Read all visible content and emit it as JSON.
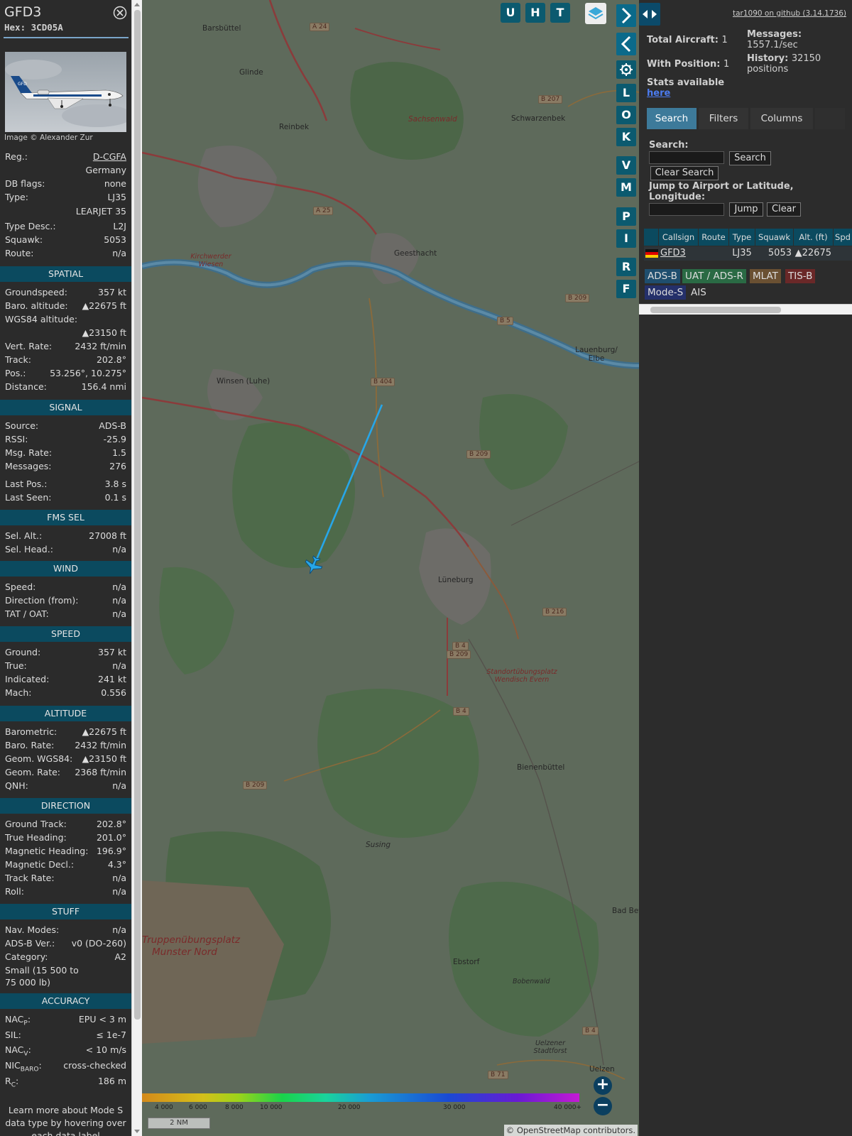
{
  "info": {
    "callsign": "GFD3",
    "hex_label": "Hex:",
    "hex": "3CD05A",
    "image_credit": "Image © Alexander Zur",
    "general": [
      {
        "k": "Reg.:",
        "v": "D-CGFA"
      },
      {
        "k": "",
        "v": "Germany"
      },
      {
        "k": "DB flags:",
        "v": "none"
      },
      {
        "k": "Type:",
        "v": "LJ35"
      },
      {
        "k": "",
        "v": "LEARJET 35"
      },
      {
        "k": "Type Desc.:",
        "v": "L2J"
      },
      {
        "k": "Squawk:",
        "v": "5053"
      },
      {
        "k": "Route:",
        "v": "n/a"
      }
    ],
    "sections": {
      "spatial": "SPATIAL",
      "signal": "SIGNAL",
      "fms": "FMS SEL",
      "wind": "WIND",
      "speed": "SPEED",
      "altitude": "ALTITUDE",
      "direction": "DIRECTION",
      "stuff": "STUFF",
      "accuracy": "ACCURACY"
    },
    "spatial": [
      {
        "k": "Groundspeed:",
        "v": "357 kt"
      },
      {
        "k": "Baro. altitude:",
        "v": "▲22675 ft"
      },
      {
        "k": "WGS84 altitude:",
        "v": ""
      },
      {
        "k": "",
        "v": "▲23150 ft"
      },
      {
        "k": "Vert. Rate:",
        "v": "2432 ft/min"
      },
      {
        "k": "Track:",
        "v": "202.8°"
      },
      {
        "k": "Pos.:",
        "v": "53.256°, 10.275°"
      },
      {
        "k": "Distance:",
        "v": "156.4 nmi"
      }
    ],
    "signal": [
      {
        "k": "Source:",
        "v": "ADS-B"
      },
      {
        "k": "RSSI:",
        "v": "-25.9"
      },
      {
        "k": "Msg. Rate:",
        "v": "1.5"
      },
      {
        "k": "Messages:",
        "v": "276"
      },
      {
        "k": "Last Pos.:",
        "v": "3.8 s"
      },
      {
        "k": "Last Seen:",
        "v": "0.1 s"
      }
    ],
    "fms": [
      {
        "k": "Sel. Alt.:",
        "v": "27008 ft"
      },
      {
        "k": "Sel. Head.:",
        "v": "n/a"
      }
    ],
    "wind": [
      {
        "k": "Speed:",
        "v": "n/a"
      },
      {
        "k": "Direction (from):",
        "v": "n/a"
      },
      {
        "k": "TAT / OAT:",
        "v": "n/a"
      }
    ],
    "speed": [
      {
        "k": "Ground:",
        "v": "357 kt"
      },
      {
        "k": "True:",
        "v": "n/a"
      },
      {
        "k": "Indicated:",
        "v": "241 kt"
      },
      {
        "k": "Mach:",
        "v": "0.556"
      }
    ],
    "altitude": [
      {
        "k": "Barometric:",
        "v": "▲22675 ft"
      },
      {
        "k": "Baro. Rate:",
        "v": "2432 ft/min"
      },
      {
        "k": "Geom. WGS84:",
        "v": "▲23150 ft"
      },
      {
        "k": "Geom. Rate:",
        "v": "2368 ft/min"
      },
      {
        "k": "QNH:",
        "v": "n/a"
      }
    ],
    "direction": [
      {
        "k": "Ground Track:",
        "v": "202.8°"
      },
      {
        "k": "True Heading:",
        "v": "201.0°"
      },
      {
        "k": "Magnetic Heading:",
        "v": "196.9°"
      },
      {
        "k": "Magnetic Decl.:",
        "v": "4.3°"
      },
      {
        "k": "Track Rate:",
        "v": "n/a"
      },
      {
        "k": "Roll:",
        "v": "n/a"
      }
    ],
    "stuff": [
      {
        "k": "Nav. Modes:",
        "v": "n/a"
      },
      {
        "k": "ADS-B Ver.:",
        "v": "v0 (DO-260)"
      },
      {
        "k": "Category:",
        "v": "A2"
      }
    ],
    "category_desc_1": "Small (15 500 to",
    "category_desc_2": "75 000 lb)",
    "accuracy": [
      {
        "k": "NAC",
        "sub": "P",
        "v": "EPU < 3 m"
      },
      {
        "k": "SIL:",
        "sub": "",
        "v": "≤ 1e-7"
      },
      {
        "k": "NAC",
        "sub": "V",
        "v": "< 10 m/s"
      },
      {
        "k": "NIC",
        "sub": "BARO",
        "v": "cross-checked"
      },
      {
        "k": "R",
        "sub": "C",
        "v": "186 m"
      }
    ],
    "footer_1": "Learn more about Mode S",
    "footer_2": "data type by hovering over",
    "footer_3": "each data label"
  },
  "map": {
    "top_buttons": [
      "U",
      "H",
      "T"
    ],
    "side_buttons": [
      "L",
      "O",
      "K",
      "V",
      "M",
      "P",
      "I",
      "R",
      "F"
    ],
    "towns": [
      {
        "name": "Barsbüttel"
      },
      {
        "name": "Glinde"
      },
      {
        "name": "Reinbek"
      },
      {
        "name": "Sachsenwald"
      },
      {
        "name": "Schwarzenbek"
      },
      {
        "name": "Geesthacht"
      },
      {
        "name": "Kirchwerder Wiesen"
      },
      {
        "name": "Winsen (Luhe)"
      },
      {
        "name": "Lauenburg/ Elbe"
      },
      {
        "name": "Lüneburg"
      },
      {
        "name": "Standortübungsplatz Wendisch Evern"
      },
      {
        "name": "Bienenbüttel"
      },
      {
        "name": "Susing"
      },
      {
        "name": "Truppenübungsplatz Munster Nord"
      },
      {
        "name": "Ebstorf"
      },
      {
        "name": "Bobenwald"
      },
      {
        "name": "Uelzener Stadtforst"
      },
      {
        "name": "Uelzen"
      },
      {
        "name": "Bad Bev"
      }
    ],
    "roads": [
      "A 24",
      "B 207",
      "A 25",
      "B 209",
      "B 5",
      "B 404",
      "B 209",
      "B 216",
      "B 4",
      "B 209",
      "B 4",
      "B 209",
      "B 4",
      "B 71"
    ],
    "colorbar_labels": [
      "4 000",
      "6 000",
      "8 000",
      "10 000",
      "20 000",
      "30 000",
      "40 000+"
    ],
    "scale": "2 NM",
    "attribution_prefix": "© ",
    "attribution_link": "OpenStreetMap",
    "attribution_suffix": " contributors."
  },
  "right": {
    "github_link": "tar1090 on github (3.14.1736)",
    "total_aircraft_label": "Total Aircraft:",
    "total_aircraft": "1",
    "with_position_label": "With Position:",
    "with_position": "1",
    "messages_label": "Messages:",
    "messages": "1557.1/sec",
    "history_label": "History:",
    "history_1": "32150",
    "history_2": "positions",
    "stats_label": "Stats available",
    "stats_link": "here",
    "tabs": [
      "Search",
      "Filters",
      "Columns"
    ],
    "search_label": "Search:",
    "search_btn": "Search",
    "clear_search_btn": "Clear Search",
    "jump_label_1": "Jump to Airport or Latitude,",
    "jump_label_2": "Longitude:",
    "jump_btn": "Jump",
    "clear_btn": "Clear",
    "table_headers": [
      "Callsign",
      "Route",
      "Type",
      "Squawk",
      "Alt. (ft)",
      "Spd"
    ],
    "table_row": {
      "callsign": "GFD3",
      "route": "",
      "type": "LJ35",
      "squawk": "5053",
      "alt": "▲22675"
    },
    "legend": [
      {
        "label": "ADS-B",
        "color": "#1f4e6e"
      },
      {
        "label": "UAT / ADS-R",
        "color": "#2a6a44"
      },
      {
        "label": "MLAT",
        "color": "#6a5032"
      },
      {
        "label": "TIS-B",
        "color": "#6a2828"
      },
      {
        "label": "Mode-S",
        "color": "#24306a"
      },
      {
        "label": "AIS",
        "color": "#2c2c2c"
      }
    ]
  }
}
